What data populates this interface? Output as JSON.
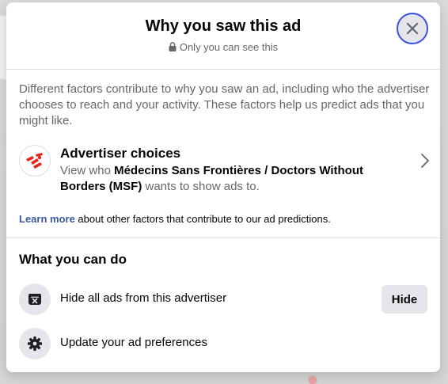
{
  "dialog": {
    "title": "Why you saw this ad",
    "privacy_note": "Only you can see this",
    "intro": "Different factors contribute to why you saw an ad, including who the advertiser chooses to reach and your activity. These factors help us predict ads that you might like."
  },
  "advertiser": {
    "heading": "Advertiser choices",
    "desc_prefix": "View who ",
    "name": "Médecins Sans Frontières / Doctors Without Borders (MSF)",
    "desc_suffix": " wants to show ads to.",
    "logo_color": "#e3261b"
  },
  "learn_more": {
    "link": "Learn more",
    "text": " about other factors that contribute to our ad predictions."
  },
  "actions": {
    "heading": "What you can do",
    "items": [
      {
        "label": "Hide all ads from this advertiser",
        "icon": "hide-ad-icon",
        "button": "Hide"
      },
      {
        "label": "Update your ad preferences",
        "icon": "gear-icon"
      }
    ]
  },
  "colors": {
    "focus_ring": "#3b4fe4",
    "link": "#385898",
    "icon_bg": "#e4e6eb"
  }
}
